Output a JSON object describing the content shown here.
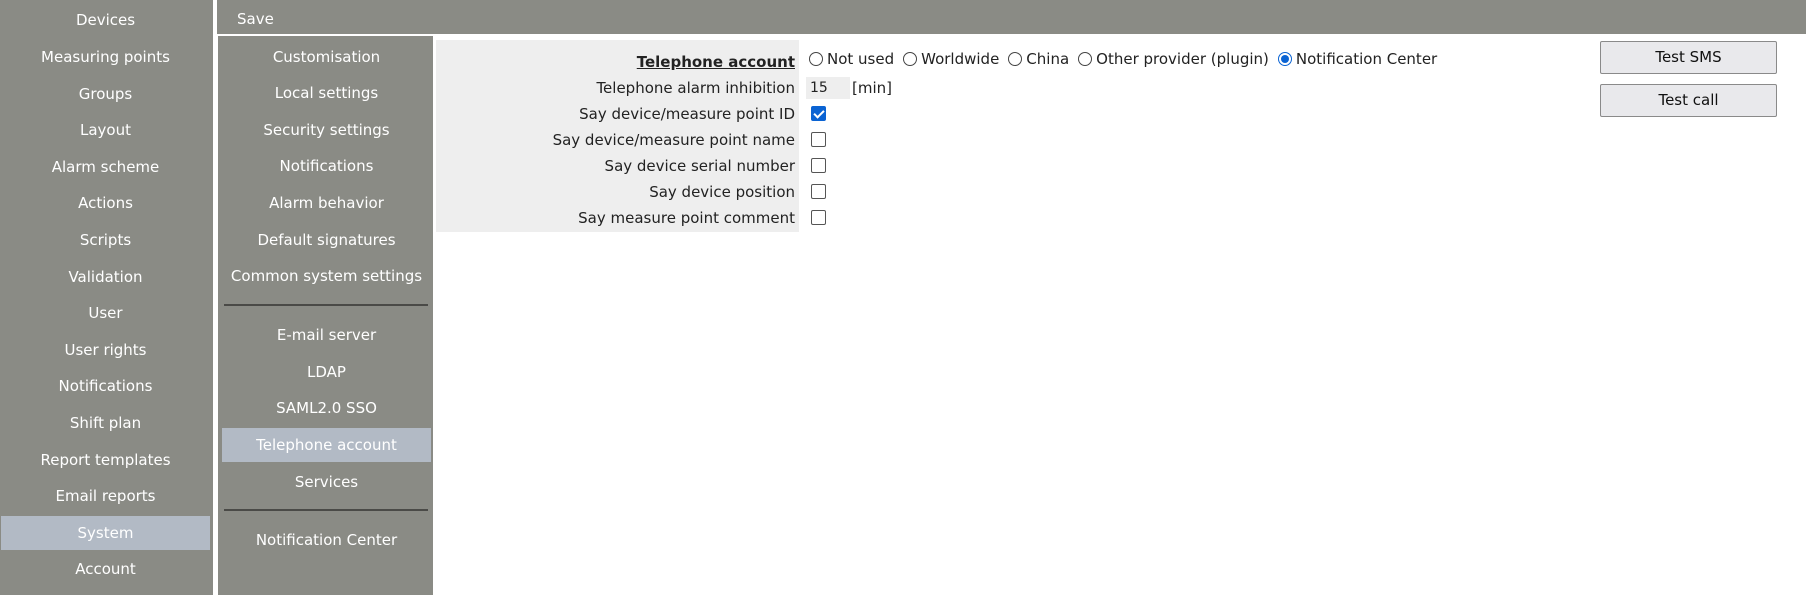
{
  "toolbar": {
    "save_label": "Save"
  },
  "left_nav": {
    "items": [
      {
        "label": "Devices"
      },
      {
        "label": "Measuring points"
      },
      {
        "label": "Groups"
      },
      {
        "label": "Layout"
      },
      {
        "label": "Alarm scheme"
      },
      {
        "label": "Actions"
      },
      {
        "label": "Scripts"
      },
      {
        "label": "Validation"
      },
      {
        "label": "User"
      },
      {
        "label": "User rights"
      },
      {
        "label": "Notifications"
      },
      {
        "label": "Shift plan"
      },
      {
        "label": "Report templates"
      },
      {
        "label": "Email reports"
      },
      {
        "label": "System",
        "active": true
      },
      {
        "label": "Account"
      }
    ]
  },
  "sub_nav": {
    "items": [
      {
        "label": "Customisation"
      },
      {
        "label": "Local settings"
      },
      {
        "label": "Security settings"
      },
      {
        "label": "Notifications"
      },
      {
        "label": "Alarm behavior"
      },
      {
        "label": "Default signatures"
      },
      {
        "label": "Common system settings"
      },
      {
        "label": "E-mail server"
      },
      {
        "label": "LDAP"
      },
      {
        "label": "SAML2.0 SSO"
      },
      {
        "label": "Telephone account",
        "active": true
      },
      {
        "label": "Services"
      },
      {
        "label": "Notification Center"
      }
    ]
  },
  "form": {
    "heading": "Telephone account",
    "provider_options": [
      {
        "label": "Not used",
        "checked": false
      },
      {
        "label": "Worldwide",
        "checked": false
      },
      {
        "label": "China",
        "checked": false
      },
      {
        "label": "Other provider (plugin)",
        "checked": false
      },
      {
        "label": "Notification Center",
        "checked": true
      }
    ],
    "inhibition": {
      "label": "Telephone alarm inhibition",
      "value": "15",
      "unit": "[min]"
    },
    "checks": [
      {
        "label": "Say device/measure point ID",
        "checked": true
      },
      {
        "label": "Say device/measure point name",
        "checked": false
      },
      {
        "label": "Say device serial number",
        "checked": false
      },
      {
        "label": "Say device position",
        "checked": false
      },
      {
        "label": "Say measure point comment",
        "checked": false
      }
    ]
  },
  "actions": {
    "test_sms": "Test SMS",
    "test_call": "Test call"
  },
  "colors": {
    "sidebar": "#8a8b85",
    "active_item": "#b2bac5",
    "accent": "#0a63d3",
    "form_panel": "#eeeeee"
  }
}
